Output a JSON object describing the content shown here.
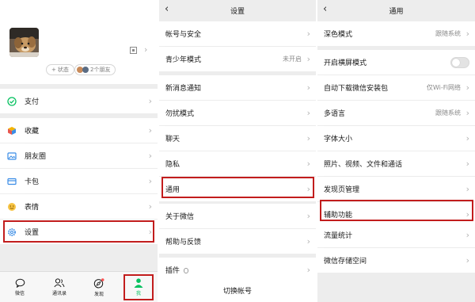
{
  "colors": {
    "accent_green": "#07c160",
    "highlight_red": "#c21d1d",
    "divider": "#ededed"
  },
  "me_page": {
    "status_button": "状态",
    "friends_button": "2个朋友",
    "menu": [
      {
        "label": "支付",
        "icon": "wallet-check-icon"
      },
      {
        "label": "收藏",
        "icon": "cube-icon"
      },
      {
        "label": "朋友圈",
        "icon": "picture-icon"
      },
      {
        "label": "卡包",
        "icon": "card-icon"
      },
      {
        "label": "表情",
        "icon": "smile-icon"
      },
      {
        "label": "设置",
        "icon": "gear-icon"
      }
    ],
    "tabbar": [
      {
        "label": "微信",
        "icon": "chat-bubble-icon"
      },
      {
        "label": "通讯录",
        "icon": "contacts-icon"
      },
      {
        "label": "发现",
        "icon": "compass-icon"
      },
      {
        "label": "我",
        "icon": "person-icon"
      }
    ]
  },
  "settings_page": {
    "title": "设置",
    "items": [
      {
        "label": "帐号与安全",
        "value": ""
      },
      {
        "label": "青少年模式",
        "value": "未开启"
      },
      {
        "label": "新消息通知",
        "value": ""
      },
      {
        "label": "勿扰模式",
        "value": ""
      },
      {
        "label": "聊天",
        "value": ""
      },
      {
        "label": "隐私",
        "value": ""
      },
      {
        "label": "通用",
        "value": ""
      },
      {
        "label": "关于微信",
        "value": ""
      },
      {
        "label": "帮助与反馈",
        "value": ""
      },
      {
        "label": "插件",
        "value": ""
      }
    ],
    "switch_account": "切换帐号"
  },
  "general_page": {
    "title": "通用",
    "items": [
      {
        "label": "深色模式",
        "value": "跟随系统"
      },
      {
        "label": "开启横屏模式",
        "value": ""
      },
      {
        "label": "自动下载微信安装包",
        "value": "仅Wi-Fi网络"
      },
      {
        "label": "多语言",
        "value": "跟随系统"
      },
      {
        "label": "字体大小",
        "value": ""
      },
      {
        "label": "照片、视频、文件和通话",
        "value": ""
      },
      {
        "label": "发现页管理",
        "value": ""
      },
      {
        "label": "辅助功能",
        "value": ""
      },
      {
        "label": "流量统计",
        "value": ""
      },
      {
        "label": "微信存储空间",
        "value": ""
      }
    ]
  }
}
